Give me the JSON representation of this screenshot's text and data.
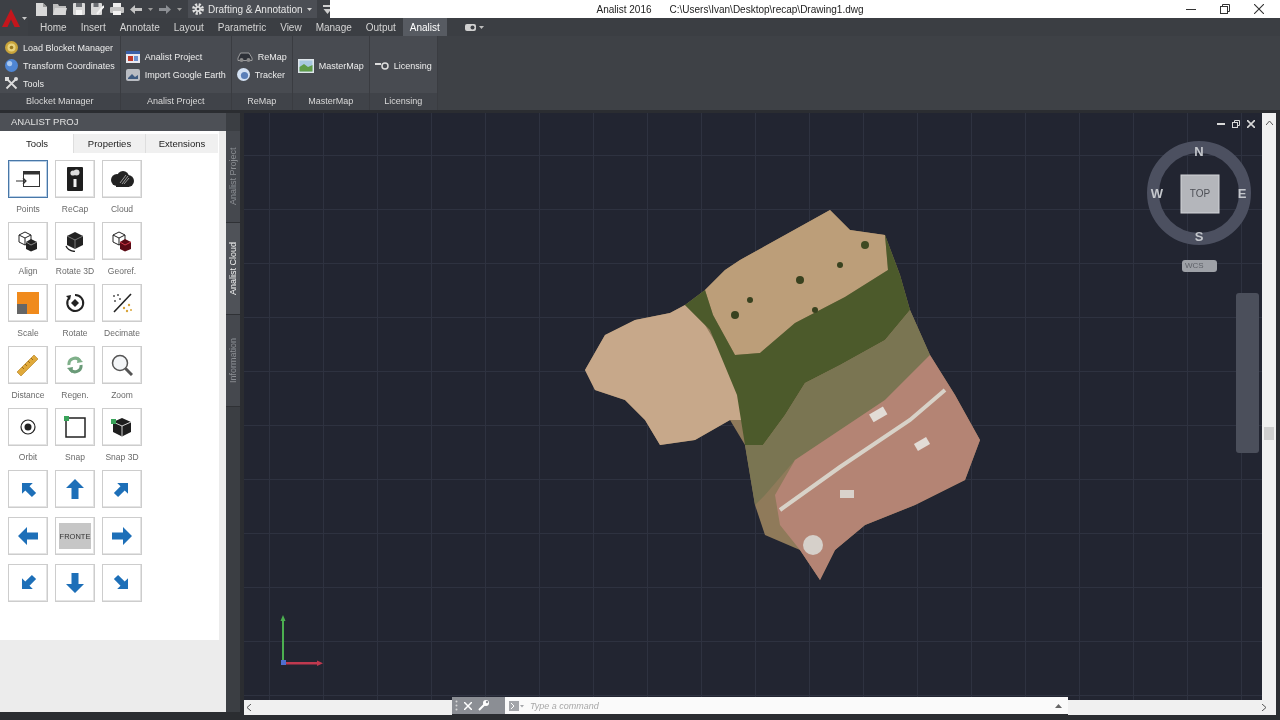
{
  "title_bar": {
    "workspace": "Drafting & Annotation",
    "app_name": "Analist 2016",
    "file_path": "C:\\Users\\Ivan\\Desktop\\recap\\Drawing1.dwg"
  },
  "ribbon_tabs": [
    {
      "label": "Home",
      "selected": false
    },
    {
      "label": "Insert",
      "selected": false
    },
    {
      "label": "Annotate",
      "selected": false
    },
    {
      "label": "Layout",
      "selected": false
    },
    {
      "label": "Parametric",
      "selected": false
    },
    {
      "label": "View",
      "selected": false
    },
    {
      "label": "Manage",
      "selected": false
    },
    {
      "label": "Output",
      "selected": false
    },
    {
      "label": "Analist",
      "selected": true
    }
  ],
  "ribbon_panels": [
    {
      "title": "Blocket Manager",
      "items": [
        "Load Blocket Manager",
        "Transform Coordinates",
        "Tools"
      ]
    },
    {
      "title": "Analist Project",
      "items": [
        "Analist Project",
        "Import Google Earth"
      ]
    },
    {
      "title": "ReMap",
      "items": [
        "ReMap",
        "Tracker"
      ]
    },
    {
      "title": "MasterMap",
      "items": [
        "MasterMap"
      ]
    },
    {
      "title": "Licensing",
      "items": [
        "Licensing"
      ]
    }
  ],
  "palette": {
    "title": "ANALIST PROJ",
    "tabs": [
      {
        "label": "Tools",
        "selected": true
      },
      {
        "label": "Properties",
        "selected": false
      },
      {
        "label": "Extensions",
        "selected": false
      }
    ],
    "tools": [
      {
        "label": "Points",
        "selected": true
      },
      {
        "label": "ReCap",
        "selected": false
      },
      {
        "label": "Cloud",
        "selected": false
      },
      {
        "label": "Align",
        "selected": false
      },
      {
        "label": "Rotate 3D",
        "selected": false
      },
      {
        "label": "Georef.",
        "selected": false
      },
      {
        "label": "Scale",
        "selected": false
      },
      {
        "label": "Rotate",
        "selected": false
      },
      {
        "label": "Decimate",
        "selected": false
      },
      {
        "label": "Distance",
        "selected": false
      },
      {
        "label": "Regen.",
        "selected": false
      },
      {
        "label": "Zoom",
        "selected": false
      },
      {
        "label": "Orbit",
        "selected": false
      },
      {
        "label": "Snap",
        "selected": false
      },
      {
        "label": "Snap 3D",
        "selected": false
      }
    ],
    "view_pad": {
      "center": "FRONTE"
    }
  },
  "side_tabs": [
    {
      "label": "Analist Project",
      "selected": false
    },
    {
      "label": "Analist Cloud",
      "selected": true
    },
    {
      "label": "Information",
      "selected": false
    }
  ],
  "viewcube": {
    "north": "N",
    "west": "W",
    "east": "E",
    "south": "S",
    "face": "TOP",
    "coordinate_system": "WCS"
  },
  "command_line": {
    "placeholder": "Type a command"
  }
}
